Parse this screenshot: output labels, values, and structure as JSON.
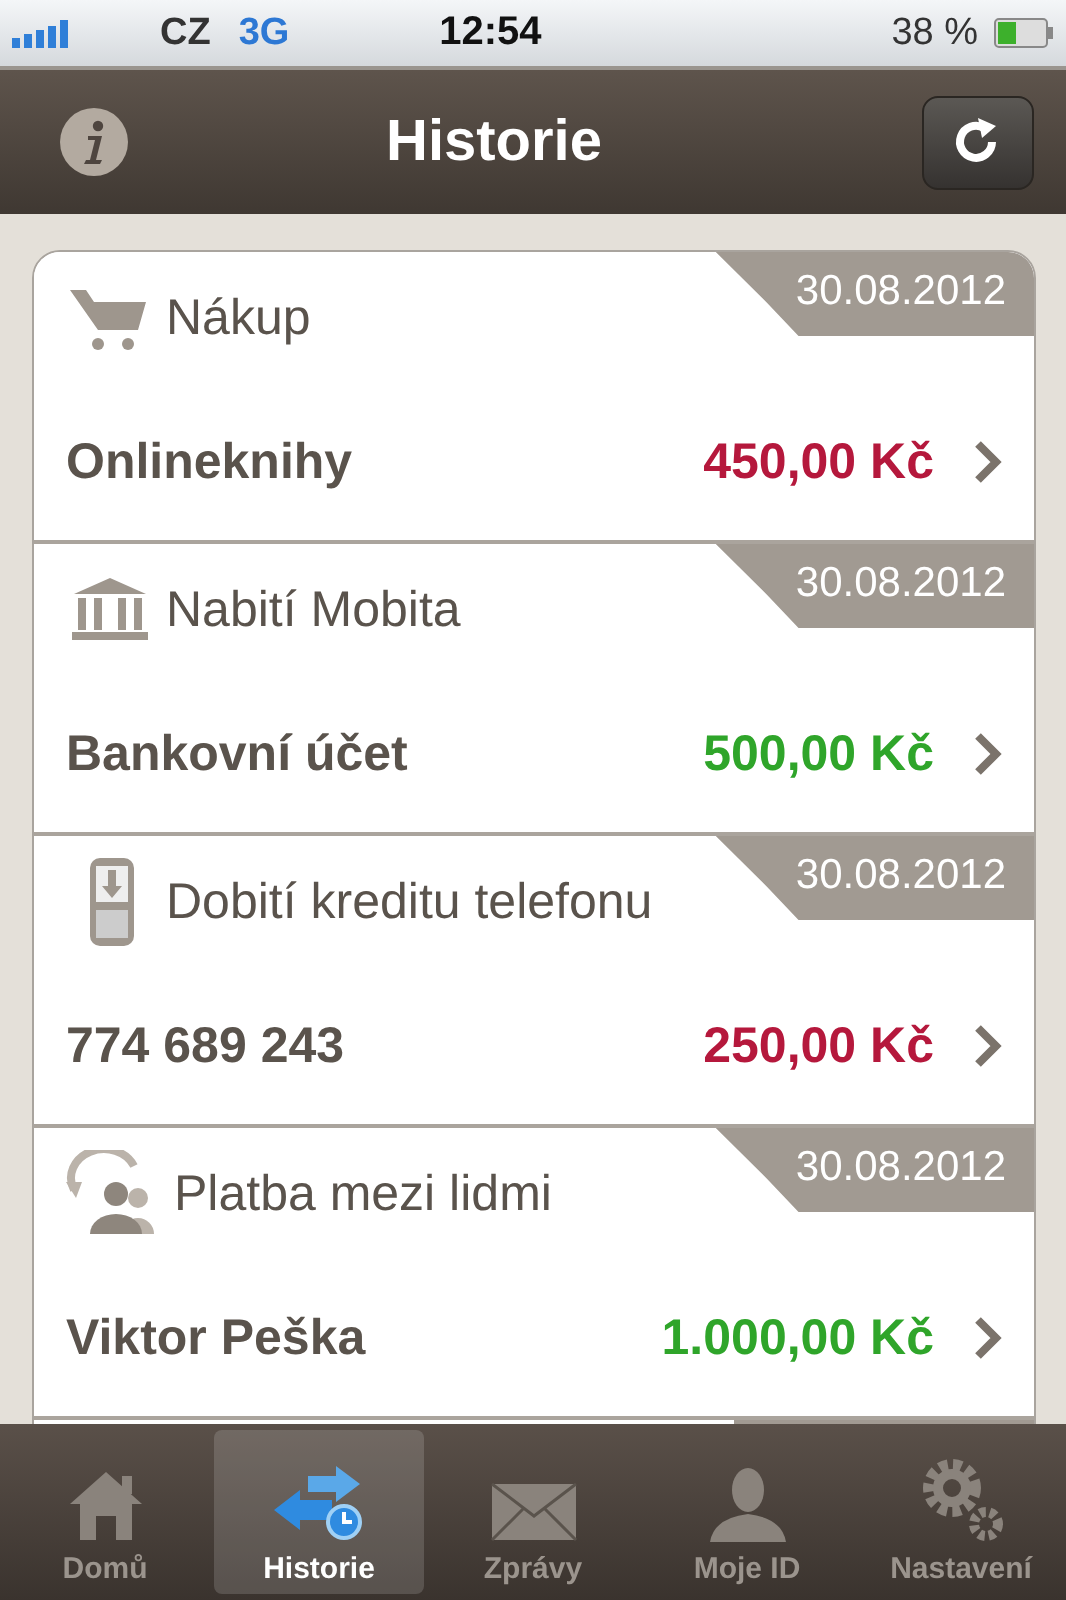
{
  "status_bar": {
    "carrier": "CZ",
    "network": "3G",
    "time": "12:54",
    "battery": "38 %"
  },
  "nav_bar": {
    "title": "Historie"
  },
  "transactions": [
    {
      "kind": "cart",
      "title": "Nákup",
      "date": "30.08.2012",
      "name": "Onlineknihy",
      "amount": "450,00 Kč",
      "color": "#b5183c"
    },
    {
      "kind": "bank",
      "title": "Nabití Mobita",
      "date": "30.08.2012",
      "name": "Bankovní účet",
      "amount": "500,00 Kč",
      "color": "#2fa52a"
    },
    {
      "kind": "phone",
      "title": "Dobití kreditu telefonu",
      "date": "30.08.2012",
      "name": "774 689 243",
      "amount": "250,00 Kč",
      "color": "#b5183c"
    },
    {
      "kind": "people",
      "title": "Platba mezi lidmi",
      "date": "30.08.2012",
      "name": "Viktor Peška",
      "amount": "1.000,00 Kč",
      "color": "#2fa52a"
    }
  ],
  "tab_bar": [
    {
      "kind": "home",
      "label": "Domů",
      "selected": false
    },
    {
      "kind": "history",
      "label": "Historie",
      "selected": true
    },
    {
      "kind": "mail",
      "label": "Zprávy",
      "selected": false
    },
    {
      "kind": "person",
      "label": "Moje ID",
      "selected": false
    },
    {
      "kind": "gears",
      "label": "Nastavení",
      "selected": false
    }
  ]
}
